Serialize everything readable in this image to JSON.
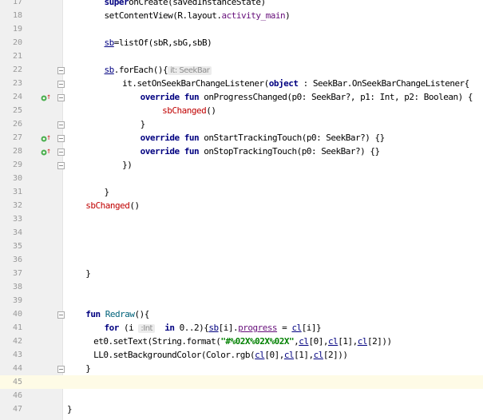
{
  "editor": {
    "lines": [
      {
        "num": "17",
        "type": "l17",
        "segs": [
          "super",
          "onCreate(savedInstanceState)"
        ]
      },
      {
        "num": "18",
        "segs": [
          "setContentView(R.layout.",
          "activity_main",
          ")"
        ]
      },
      {
        "num": "19"
      },
      {
        "num": "20",
        "segs": [
          "sb",
          "=listOf(sbR,sbG,sbB)"
        ]
      },
      {
        "num": "21"
      },
      {
        "num": "22",
        "segs": [
          "sb",
          ".forEach(){",
          "it: SeekBar"
        ]
      },
      {
        "num": "23",
        "segs": [
          "it.setOnSeekBarChangeListener(",
          "object",
          " : SeekBar.OnSeekBarChangeListener{"
        ]
      },
      {
        "num": "24",
        "segs": [
          "override fun",
          " onProgressChanged(p0: SeekBar?, p1: Int, p2: Boolean) {"
        ]
      },
      {
        "num": "25",
        "segs": [
          "sbChanged",
          "()"
        ]
      },
      {
        "num": "26",
        "segs": [
          "}"
        ]
      },
      {
        "num": "27",
        "segs": [
          "override fun",
          " onStartTrackingTouch(p0: SeekBar?) {}"
        ]
      },
      {
        "num": "28",
        "segs": [
          "override fun",
          " onStopTrackingTouch(p0: SeekBar?) {}"
        ]
      },
      {
        "num": "29",
        "segs": [
          "})"
        ]
      },
      {
        "num": "30"
      },
      {
        "num": "31",
        "segs": [
          "}"
        ]
      },
      {
        "num": "32",
        "segs": [
          "sbChanged",
          "()"
        ]
      },
      {
        "num": "33"
      },
      {
        "num": "34"
      },
      {
        "num": "35"
      },
      {
        "num": "36"
      },
      {
        "num": "37",
        "segs": [
          "}"
        ]
      },
      {
        "num": "38"
      },
      {
        "num": "39"
      },
      {
        "num": "40",
        "segs": [
          "fun",
          " Redraw",
          "(){"
        ]
      },
      {
        "num": "41",
        "segs": [
          "for",
          " (i ",
          ":Int",
          "  in 0..2){",
          "sb",
          "[i].",
          "progress",
          " = ",
          "cl",
          "[i]}"
        ]
      },
      {
        "num": "42",
        "segs": [
          "et0.setText(String.format(",
          "\"#%02X%02X%02X\"",
          ",",
          "cl",
          "[0],",
          "cl",
          "[1],",
          "cl",
          "[2]))"
        ]
      },
      {
        "num": "43",
        "segs": [
          "LL0.setBackgroundColor(Color.rgb(",
          "cl",
          "[0],",
          "cl",
          "[1],",
          "cl",
          "[2]))"
        ]
      },
      {
        "num": "44",
        "segs": [
          "}"
        ]
      },
      {
        "num": "45"
      },
      {
        "num": "46"
      },
      {
        "num": "47",
        "segs": [
          "}"
        ]
      }
    ]
  },
  "colors": {
    "keyword": "#000080",
    "string": "#008000",
    "property": "#660e7a",
    "error_call": "#c00000",
    "current_line": "#fefbe6",
    "gutter": "#f0f0f0"
  },
  "icons": [
    "override-marker-icon",
    "fold-marker-icon"
  ]
}
